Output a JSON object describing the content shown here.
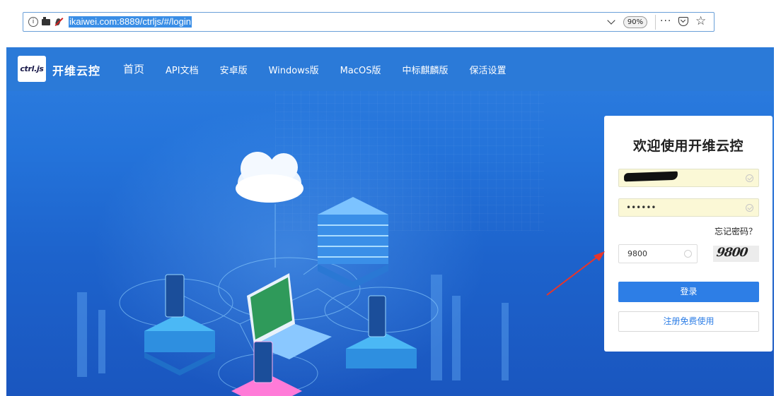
{
  "browser": {
    "url": "ikaiwei.com:8889/ctrljs/#/login",
    "zoom": "90%",
    "more_label": "···",
    "info_icon": "info-icon",
    "camera_icon": "camera-icon",
    "mic_icon": "microphone-muted-icon"
  },
  "header": {
    "logo_text": "ctrl.js",
    "brand": "开维云控",
    "nav": [
      "首页",
      "API文档",
      "安卓版",
      "Windows版",
      "MacOS版",
      "中标麒麟版",
      "保活设置"
    ]
  },
  "login": {
    "title": "欢迎使用开维云控",
    "password_mask": "••••••",
    "forgot_label": "忘记密码？",
    "captcha_value": "9800",
    "captcha_image_text": "9800",
    "login_button": "登录",
    "register_button": "注册免费使用"
  },
  "colors": {
    "accent": "#2d7ee6",
    "header": "#2b7ad8",
    "autofill": "#fbf8d6",
    "annotation_arrow": "#e8352a"
  }
}
